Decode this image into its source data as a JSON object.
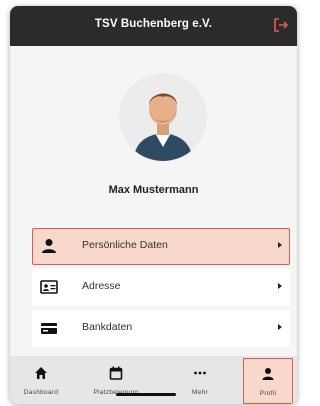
{
  "header": {
    "title": "TSV Buchenberg e.V.",
    "logout_icon": "logout-icon"
  },
  "profile": {
    "name": "Max Mustermann"
  },
  "menu": {
    "items": [
      {
        "label": "Persönliche Daten",
        "icon": "person-icon",
        "active": true
      },
      {
        "label": "Adresse",
        "icon": "id-card-icon",
        "active": false
      },
      {
        "label": "Bankdaten",
        "icon": "credit-card-icon",
        "active": false
      }
    ]
  },
  "bottom_nav": {
    "items": [
      {
        "label": "Dashboard",
        "icon": "home-icon"
      },
      {
        "label": "Platzbelegung",
        "icon": "calendar-icon"
      },
      {
        "label": "Mehr",
        "icon": "more-icon"
      },
      {
        "label": "Profil",
        "icon": "profile-icon",
        "active": true
      }
    ]
  },
  "colors": {
    "header_bg": "#2b2b2b",
    "accent": "#e15b5b",
    "active_bg": "#f7d8cb"
  }
}
